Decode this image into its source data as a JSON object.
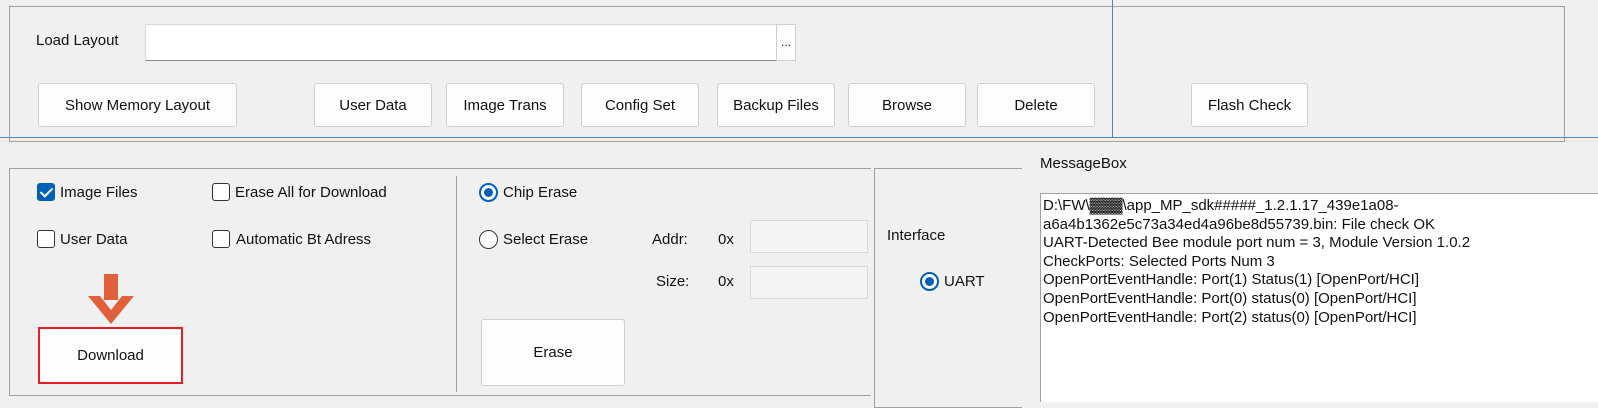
{
  "top": {
    "load_layout_label": "Load Layout",
    "load_layout_value": "",
    "browse_dots": "...",
    "buttons": {
      "show_memory_layout": "Show Memory Layout",
      "user_data": "User Data",
      "image_trans": "Image Trans",
      "config_set": "Config Set",
      "backup_files": "Backup Files",
      "browse": "Browse",
      "delete": "Delete",
      "flash_check": "Flash Check"
    }
  },
  "download_panel": {
    "image_files": {
      "label": "Image Files",
      "checked": true
    },
    "erase_all": {
      "label": "Erase All for Download",
      "checked": false
    },
    "user_data": {
      "label": "User Data",
      "checked": false
    },
    "automatic_bt": {
      "label": "Automatic Bt Adress",
      "checked": false
    },
    "download_button": "Download"
  },
  "erase_panel": {
    "chip_erase": {
      "label": "Chip Erase",
      "selected": true
    },
    "select_erase": {
      "label": "Select Erase",
      "selected": false
    },
    "addr_label": "Addr:",
    "size_label": "Size:",
    "hex_prefix": "0x",
    "addr_value": "",
    "size_value": "",
    "erase_button": "Erase"
  },
  "interface_panel": {
    "label": "Interface",
    "uart": {
      "label": "UART",
      "selected": true
    }
  },
  "message_box": {
    "title": "MessageBox",
    "lines": [
      "D:\\FW\\▓▓▓\\app_MP_sdk#####_1.2.1.17_439e1a08-",
      "a6a4b1362e5c73a34ed4a96be8d55739.bin: File check OK",
      "UART-Detected Bee module port num = 3, Module Version 1.0.2",
      "CheckPorts: Selected Ports Num 3",
      "OpenPortEventHandle: Port(1) Status(1) [OpenPort/HCI]",
      "OpenPortEventHandle: Port(0) status(0) [OpenPort/HCI]",
      "OpenPortEventHandle: Port(2) status(0) [OpenPort/HCI]"
    ]
  },
  "colors": {
    "accent": "#005fb8",
    "annotation": "#e31e24",
    "arrow": "#e0603c",
    "guide": "#4a86c8"
  }
}
